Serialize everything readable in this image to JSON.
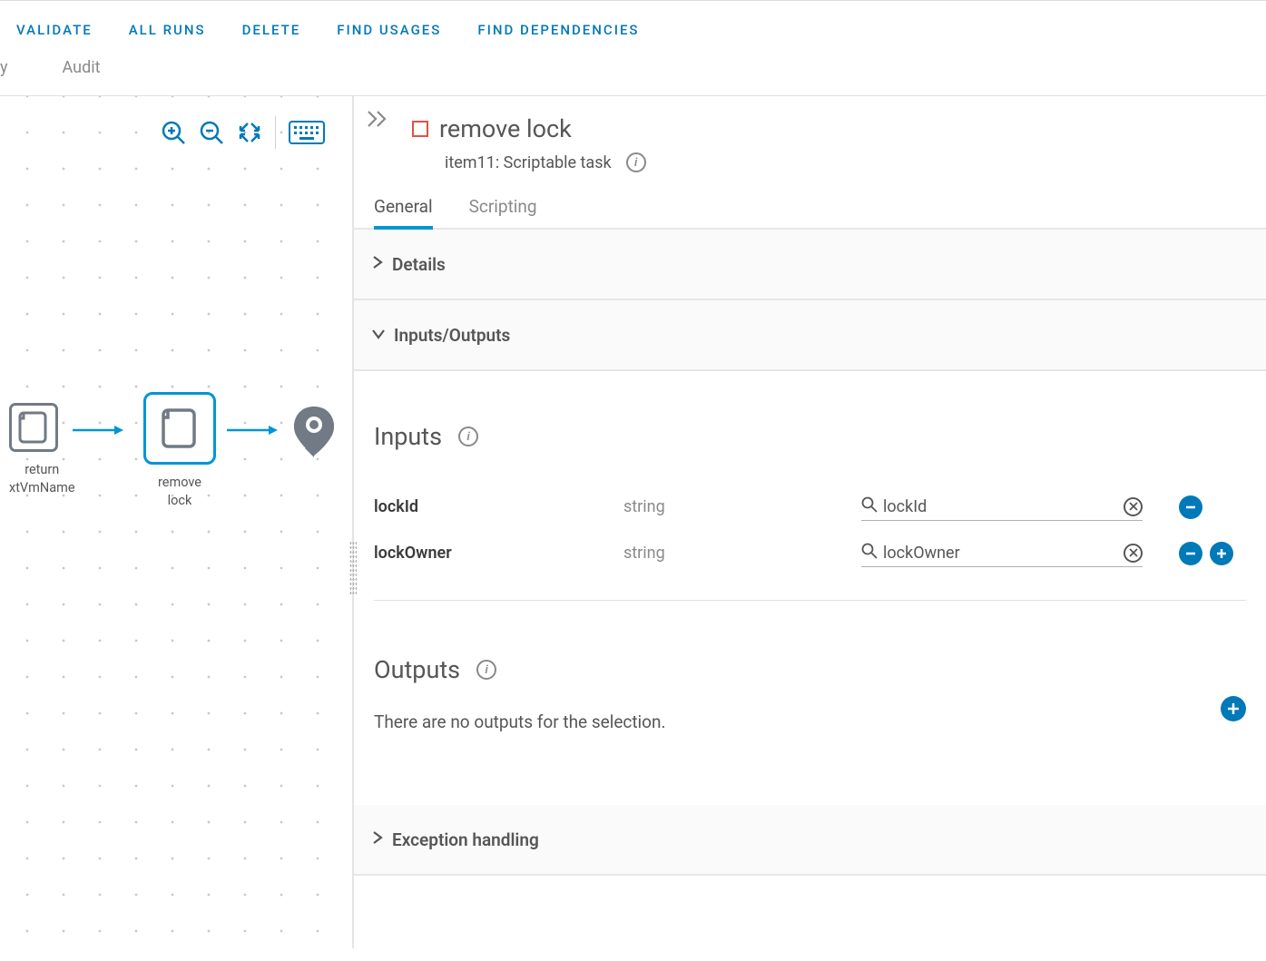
{
  "toolbar": {
    "validate": "VALIDATE",
    "all_runs": "ALL RUNS",
    "delete": "DELETE",
    "find_usages": "FIND USAGES",
    "find_dependencies": "FIND DEPENDENCIES"
  },
  "subtabs": {
    "cut": "y",
    "audit": "Audit"
  },
  "canvas": {
    "node1_label": "return\nxtVmName",
    "node2_label": "remove\nlock"
  },
  "panel": {
    "title": "remove lock",
    "subtitle": "item11: Scriptable task",
    "tabs": {
      "general": "General",
      "scripting": "Scripting"
    },
    "sections": {
      "details": "Details",
      "inputs_outputs": "Inputs/Outputs",
      "exception": "Exception handling"
    },
    "inputs": {
      "heading": "Inputs",
      "rows": [
        {
          "name": "lockId",
          "type": "string",
          "value": "lockId"
        },
        {
          "name": "lockOwner",
          "type": "string",
          "value": "lockOwner"
        }
      ]
    },
    "outputs": {
      "heading": "Outputs",
      "empty": "There are no outputs for the selection."
    }
  }
}
